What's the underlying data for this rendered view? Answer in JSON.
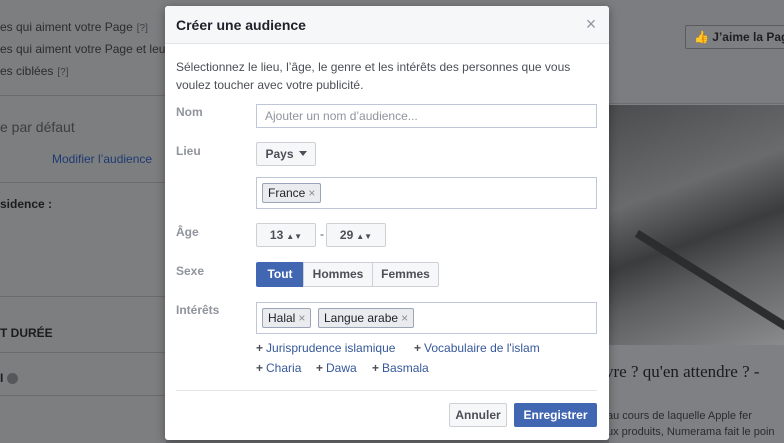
{
  "background": {
    "left": {
      "row1": "es qui aiment votre Page",
      "row1_hint": "[?]",
      "row2": "es qui aiment votre Page et leu",
      "row3": "es ciblées",
      "row3_hint": "[?]",
      "default_label": "e par défaut",
      "modify_link": "Modifier l’audience",
      "residence": "sidence :",
      "duration": "T DURÉE",
      "info_row": "I"
    },
    "right": {
      "like_button": "J’aime la Pag",
      "headline": "vre ? qu'en attendre ? -",
      "body1": "au cours de laquelle Apple fer",
      "body2": "ux produits, Numerama fait le poin"
    }
  },
  "modal": {
    "title": "Créer une audience",
    "close": "×",
    "intro": "Sélectionnez le lieu, l’âge, le genre et les intérêts des personnes que vous voulez toucher avec votre publicité.",
    "name": {
      "label": "Nom",
      "placeholder": "Ajouter un nom d’audience..."
    },
    "location": {
      "label": "Lieu",
      "dropdown": "Pays",
      "tags": [
        "France"
      ]
    },
    "age": {
      "label": "Âge",
      "min": "13",
      "max": "29",
      "separator": "-"
    },
    "gender": {
      "label": "Sexe",
      "options": [
        "Tout",
        "Hommes",
        "Femmes"
      ],
      "selected": "Tout"
    },
    "interests": {
      "label": "Intérêts",
      "tags": [
        "Halal",
        "Langue arabe"
      ],
      "suggestions": [
        "Jurisprudence islamique",
        "Vocabulaire de l'islam",
        "Charia",
        "Dawa",
        "Basmala"
      ]
    },
    "cancel": "Annuler",
    "save": "Enregistrer"
  },
  "colors": {
    "primary": "#4267b2",
    "link": "#365899",
    "header_bg": "#f6f7f9"
  }
}
